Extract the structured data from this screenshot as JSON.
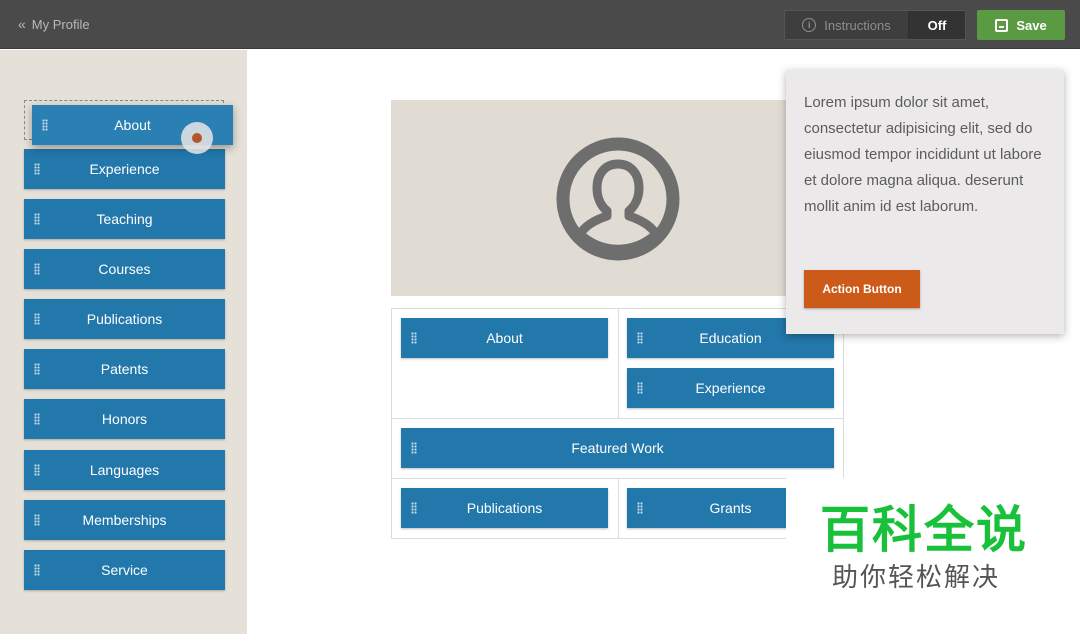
{
  "topbar": {
    "back_label": "My Profile",
    "instructions_label": "Instructions",
    "instructions_state": "Off",
    "save_label": "Save"
  },
  "sidebar": {
    "dragging_label": "About",
    "items": [
      {
        "label": "Experience"
      },
      {
        "label": "Teaching"
      },
      {
        "label": "Courses"
      },
      {
        "label": "Publications"
      },
      {
        "label": "Patents"
      },
      {
        "label": "Honors"
      },
      {
        "label": "Languages"
      },
      {
        "label": "Memberships"
      },
      {
        "label": "Service"
      }
    ]
  },
  "layout": {
    "left_col_block": "About",
    "right_col_blocks": [
      "Education",
      "Experience"
    ],
    "full_width_block": "Featured Work",
    "bottom_left_block": "Publications",
    "bottom_right_block": "Grants"
  },
  "popover": {
    "text": "Lorem ipsum dolor sit amet, consectetur adipisicing elit, sed do eiusmod tempor incididunt ut labore et dolore magna aliqua. deserunt mollit anim id est laborum.",
    "action_label": "Action Button"
  },
  "watermark": {
    "title": "百科全说",
    "subtitle": "助你轻松解决"
  },
  "colors": {
    "block_blue": "#2277ab",
    "save_green": "#5a9a43",
    "action_orange": "#cc5a18",
    "sidebar_bg": "#e5e1d9"
  }
}
